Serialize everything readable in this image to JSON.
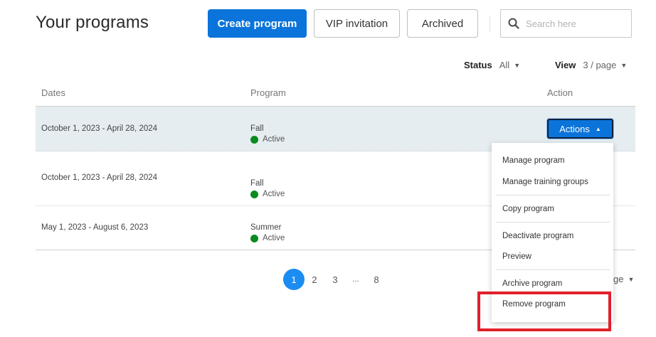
{
  "header": {
    "title": "Your programs",
    "create_label": "Create program",
    "vip_label": "VIP invitation",
    "archived_label": "Archived",
    "search_placeholder": "Search here"
  },
  "filters": {
    "status_label": "Status",
    "status_value": "All",
    "view_label": "View",
    "view_value": "3 / page"
  },
  "table": {
    "columns": [
      "Dates",
      "Program",
      "Action"
    ],
    "rows": [
      {
        "dates": "October 1, 2023 - April 28, 2024",
        "program": "Fall",
        "status": "Active"
      },
      {
        "dates": "October 1, 2023 - April 28, 2024",
        "program": "Fall",
        "status": "Active"
      },
      {
        "dates": "May 1, 2023 - August 6, 2023",
        "program": "Summer",
        "status": "Active"
      }
    ],
    "actions_label": "Actions"
  },
  "actions_menu": {
    "items": [
      "Manage program",
      "Manage training groups",
      "Copy program",
      "Deactivate program",
      "Preview",
      "Archive program",
      "Remove program"
    ]
  },
  "pagination": {
    "pages": [
      "1",
      "2",
      "3",
      "...",
      "8"
    ],
    "current": 1,
    "per_page_fragment": "ge"
  },
  "colors": {
    "primary": "#0a74da",
    "active_status": "#0b8a1f",
    "selected_row": "#e5edf1",
    "highlight": "#e0202a"
  },
  "icons": {
    "search": "search-icon",
    "caret_down": "caret-down-icon",
    "caret_up": "caret-up-icon"
  }
}
